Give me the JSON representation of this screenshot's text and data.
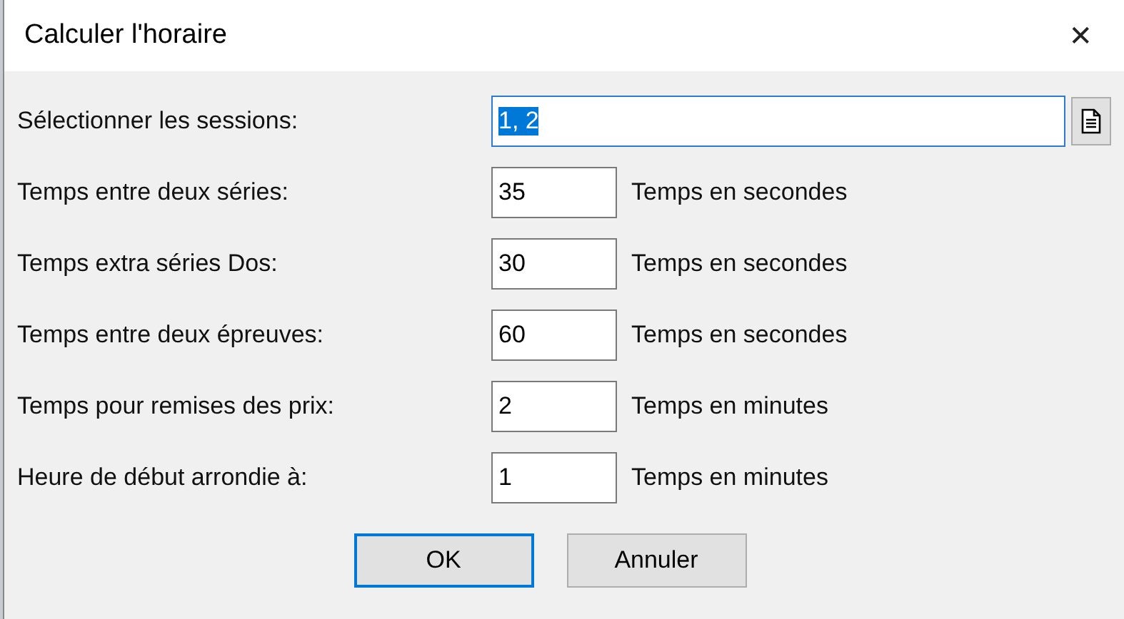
{
  "window": {
    "title": "Calculer l'horaire",
    "close": "✕"
  },
  "sessions": {
    "label": "Sélectionner les sessions:",
    "value": "1, 2",
    "focused": true
  },
  "rows": [
    {
      "label": "Temps entre deux séries:",
      "value": "35",
      "unit": "Temps en secondes"
    },
    {
      "label": "Temps extra séries Dos:",
      "value": "30",
      "unit": "Temps en secondes"
    },
    {
      "label": "Temps entre deux épreuves:",
      "value": "60",
      "unit": "Temps en secondes"
    },
    {
      "label": "Temps pour remises des prix:",
      "value": "2",
      "unit": "Temps en minutes"
    },
    {
      "label": "Heure de début arrondie à:",
      "value": "1",
      "unit": "Temps en minutes"
    }
  ],
  "buttons": [
    {
      "label": "OK",
      "default": true
    },
    {
      "label": "Annuler",
      "default": false
    }
  ]
}
